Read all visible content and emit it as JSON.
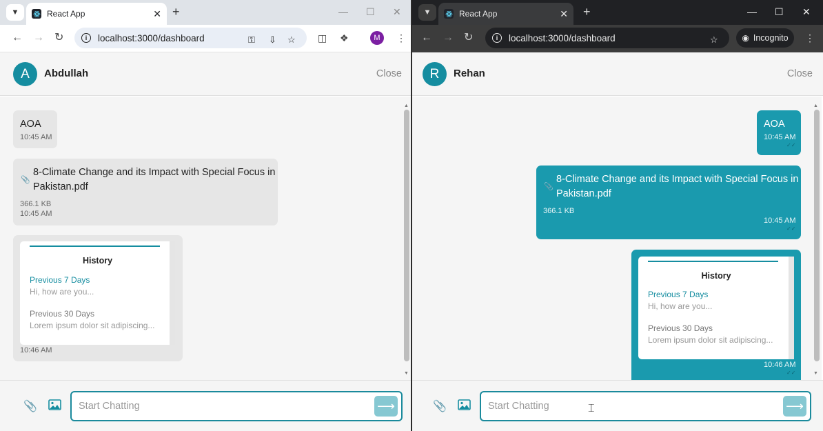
{
  "colors": {
    "accent": "#158da0",
    "bubble_out": "#1a9aae",
    "bubble_in": "#e6e6e6",
    "send_disabled": "#86c8d2"
  },
  "left": {
    "tab_title": "React App",
    "url": "localhost:3000/dashboard",
    "profile_initial": "M",
    "chat": {
      "avatar_initial": "A",
      "name": "Abdullah",
      "close_label": "Close",
      "messages": [
        {
          "text": "AOA",
          "time": "10:45 AM"
        },
        {
          "file_line1": "8-Climate Change and its Impact with Special Focus in",
          "file_line2": "Pakistan.pdf",
          "size": "366.1 KB",
          "time": "10:45 AM"
        },
        {
          "card": {
            "title": "History",
            "sec1_label": "Previous 7 Days",
            "sec1_text": "Hi, how are you...",
            "sec2_label": "Previous 30 Days",
            "sec2_text": "Lorem ipsum dolor sit adipiscing..."
          },
          "time": "10:46 AM"
        }
      ],
      "input_placeholder": "Start Chatting"
    }
  },
  "right": {
    "tab_title": "React App",
    "url": "localhost:3000/dashboard",
    "incognito_label": "Incognito",
    "chat": {
      "avatar_initial": "R",
      "name": "Rehan",
      "close_label": "Close",
      "messages": [
        {
          "text": "AOA",
          "time": "10:45 AM"
        },
        {
          "file_line1": "8-Climate Change and its Impact with Special Focus in",
          "file_line2": "Pakistan.pdf",
          "size": "366.1 KB",
          "time": "10:45 AM"
        },
        {
          "card": {
            "title": "History",
            "sec1_label": "Previous 7 Days",
            "sec1_text": "Hi, how are you...",
            "sec2_label": "Previous 30 Days",
            "sec2_text": "Lorem ipsum dolor sit adipiscing..."
          },
          "time": "10:46 AM"
        }
      ],
      "input_placeholder": "Start Chatting"
    }
  },
  "icons": {
    "paperclip": "paperclip-icon",
    "image": "image-icon",
    "send": "send-arrow-icon",
    "react": "react-icon",
    "incognito": "incognito-icon"
  }
}
